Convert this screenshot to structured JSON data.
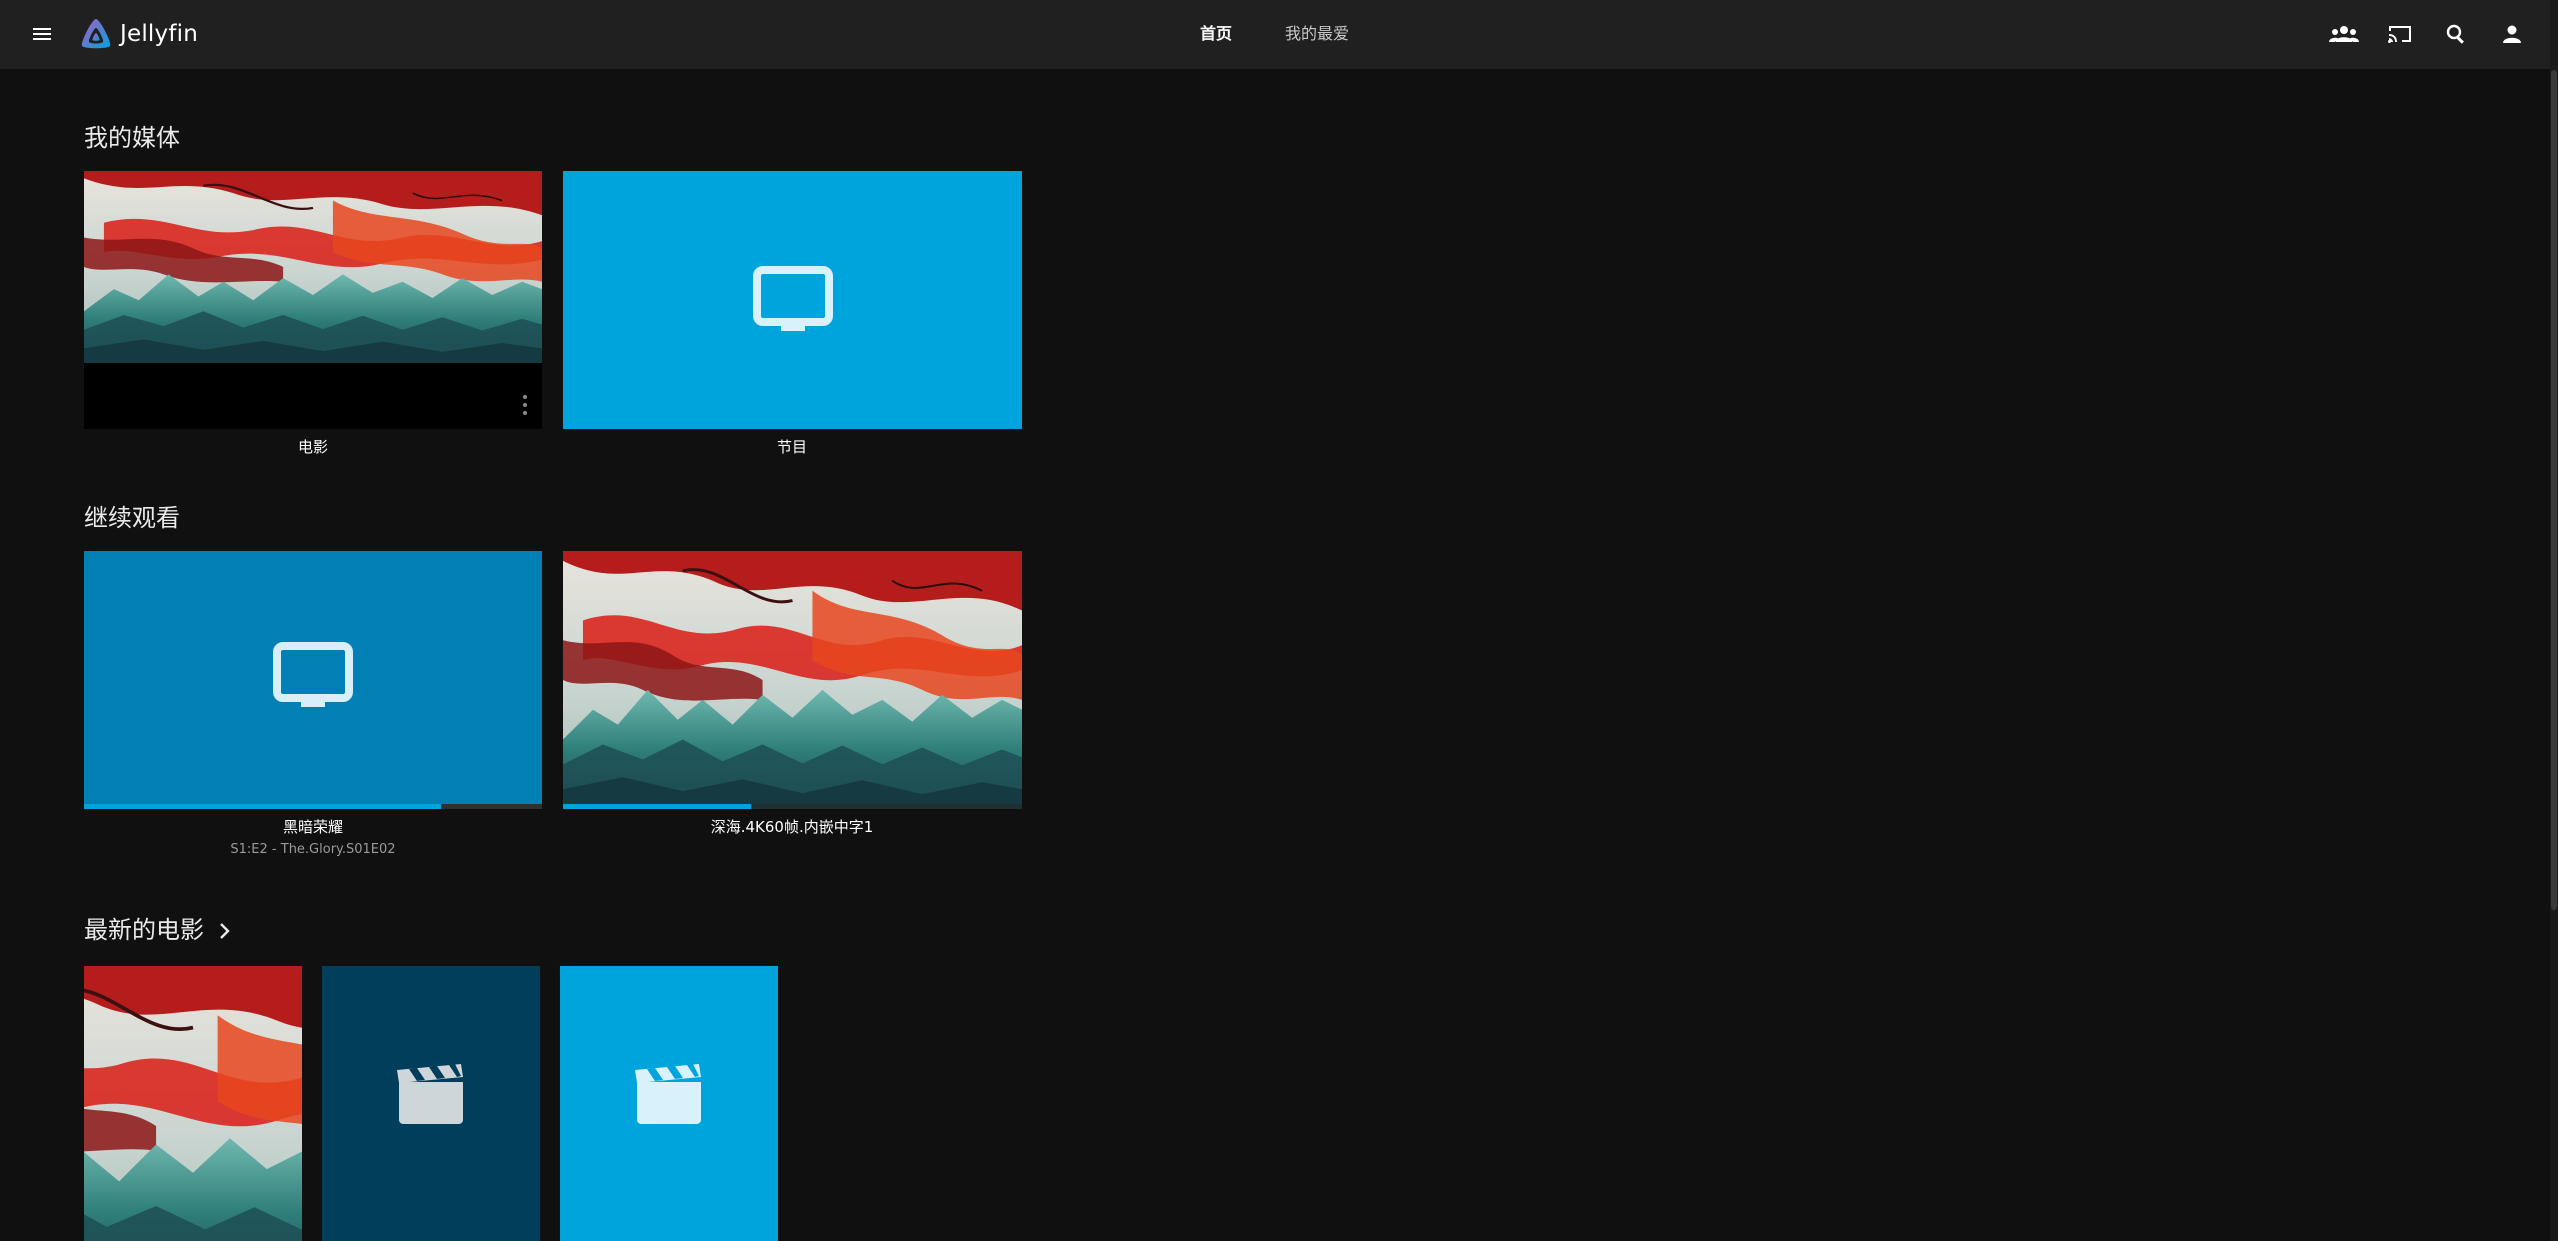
{
  "app": {
    "name": "Jellyfin"
  },
  "header": {
    "menu_icon": "menu-icon",
    "tabs": [
      {
        "label": "首页",
        "active": true
      },
      {
        "label": "我的最爱",
        "active": false
      }
    ],
    "right_icons": [
      "sync-play-icon",
      "cast-icon",
      "search-icon",
      "user-icon"
    ]
  },
  "colors": {
    "background": "#101010",
    "header": "#202020",
    "accent": "#00a4dc",
    "tile_dark_blue": "#0080b4",
    "tile_navy": "#003e5c"
  },
  "sections": {
    "my_media": {
      "title": "我的媒体",
      "items": [
        {
          "label": "电影",
          "type": "artwork",
          "icon": "more-vert-icon"
        },
        {
          "label": "节目",
          "type": "placeholder",
          "icon": "tv-icon"
        }
      ]
    },
    "continue_watching": {
      "title": "继续观看",
      "items": [
        {
          "label": "黑暗荣耀",
          "sublabel": "S1:E2 - The.Glory.S01E02",
          "type": "placeholder",
          "icon": "tv-icon",
          "progress": 0.78
        },
        {
          "label": "深海.4K60帧.内嵌中字1",
          "type": "artwork",
          "progress": 0.41
        }
      ]
    },
    "latest_movies": {
      "title": "最新的电影",
      "chevron_icon": "chevron-right-icon",
      "items": [
        {
          "type": "artwork"
        },
        {
          "type": "placeholder",
          "icon": "clapperboard-icon"
        },
        {
          "type": "placeholder",
          "icon": "clapperboard-icon"
        }
      ]
    }
  }
}
